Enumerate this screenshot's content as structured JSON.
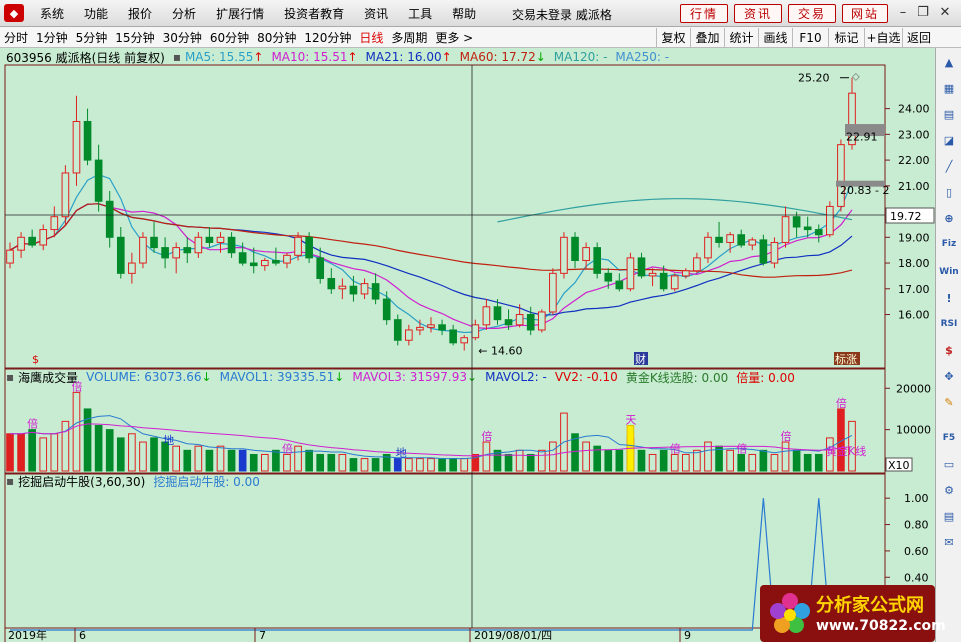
{
  "menu": {
    "logo_icon": "app-logo-icon",
    "items": [
      "系统",
      "功能",
      "报价",
      "分析",
      "扩展行情",
      "投资者教育",
      "资讯",
      "工具",
      "帮助"
    ],
    "status": "交易未登录 威派格",
    "right_buttons": [
      "行情",
      "资讯",
      "交易",
      "网站"
    ],
    "window_controls": [
      "minimize-icon",
      "restore-icon",
      "close-icon"
    ]
  },
  "tabs": {
    "periods": [
      "分时",
      "1分钟",
      "5分钟",
      "15分钟",
      "30分钟",
      "60分钟",
      "80分钟",
      "120分钟",
      "日线",
      "多周期",
      "更多 >"
    ],
    "active": "日线",
    "right": [
      "复权",
      "叠加",
      "统计",
      "画线",
      "F10",
      "标记",
      "+自选",
      "返回"
    ]
  },
  "main_info": {
    "title": "603956 威派格(日线 前复权)",
    "ma5": "MA5: 15.55",
    "ma10": "MA10: 15.51",
    "ma21": "MA21: 16.00",
    "ma60": "MA60: 17.72",
    "ma120": "MA120: -",
    "ma250": "MA250: -",
    "ma_colors": {
      "ma5": "#2aa0c8",
      "ma10": "#d020d0",
      "ma21": "#1030c0",
      "ma60": "#c02010",
      "ma120": "#30a0a0",
      "ma250": "#4090d0"
    }
  },
  "price_axis": [
    "24.00",
    "23.00",
    "22.00",
    "21.00",
    "20.00",
    "19.00",
    "18.00",
    "17.00",
    "16.00"
  ],
  "price_labels": {
    "high": "25.20",
    "low": "14.60",
    "mark1": "22.91",
    "mark2": "20.83 - 2",
    "crosshair": "19.72"
  },
  "markers": {
    "dollar": "$",
    "cai": "财",
    "biaozhang": "标涨"
  },
  "volume_info": {
    "name": "海鹰成交量",
    "volume": "VOLUME: 63073.66",
    "mavol1": "MAVOL1: 39335.51",
    "mavol3": "MAVOL3: 31597.93",
    "mavol2": "MAVOL2: -",
    "vv2": "VV2: -0.10",
    "gold": "黄金K线选股: 0.00",
    "beiliang": "倍量: 0.00",
    "axis": [
      "20000",
      "10000"
    ],
    "unit": "X10",
    "labels": {
      "bei": "倍",
      "di": "地",
      "tian": "天",
      "huangjin": "黄金K线"
    }
  },
  "indicator_info": {
    "name": "挖掘启动牛股(3,60,30)",
    "value": "挖掘启动牛股: 0.00",
    "axis": [
      "1.00",
      "0.80",
      "0.60",
      "0.40",
      "0.20"
    ]
  },
  "date_axis": [
    "2019年",
    "6",
    "7",
    "2019/08/01/四",
    "9"
  ],
  "watermark": {
    "line1": "分析家公式网",
    "line2": "www.70822.com"
  },
  "sidebar_icons": [
    "scroll-up-icon",
    "grid-icon",
    "bar-icon",
    "chart-icon",
    "line-icon",
    "candle-icon",
    "zoom-icon",
    "fiz-icon",
    "win-icon",
    "alert-icon",
    "rsi-icon",
    "money-icon",
    "move-icon",
    "pen-icon",
    "f5-icon",
    "window-icon",
    "settings-icon",
    "doc-icon",
    "email-icon"
  ],
  "chart_data": [
    {
      "type": "candlestick",
      "title": "603956 威派格(日线 前复权)",
      "y_axis": {
        "min": 14.0,
        "max": 25.5,
        "ticks": [
          16,
          17,
          18,
          19,
          20,
          21,
          22,
          23,
          24
        ]
      },
      "highest": 25.2,
      "lowest": 14.6,
      "candles": [
        [
          18.0,
          18.8,
          17.8,
          18.5
        ],
        [
          18.5,
          19.2,
          18.2,
          19.0
        ],
        [
          19.0,
          19.3,
          18.6,
          18.7
        ],
        [
          18.7,
          19.5,
          18.5,
          19.3
        ],
        [
          19.3,
          20.2,
          19.0,
          19.8
        ],
        [
          19.8,
          21.8,
          19.5,
          21.5
        ],
        [
          21.5,
          24.5,
          21.0,
          23.5
        ],
        [
          23.5,
          24.0,
          21.8,
          22.0
        ],
        [
          22.0,
          22.6,
          20.0,
          20.4
        ],
        [
          20.4,
          20.8,
          18.6,
          19.0
        ],
        [
          19.0,
          19.4,
          17.4,
          17.6
        ],
        [
          17.6,
          18.4,
          17.2,
          18.0
        ],
        [
          18.0,
          19.2,
          17.8,
          19.0
        ],
        [
          19.0,
          19.6,
          18.4,
          18.6
        ],
        [
          18.6,
          19.0,
          17.8,
          18.2
        ],
        [
          18.2,
          18.8,
          17.6,
          18.6
        ],
        [
          18.6,
          19.0,
          18.0,
          18.4
        ],
        [
          18.4,
          19.2,
          18.2,
          19.0
        ],
        [
          19.0,
          19.4,
          18.6,
          18.8
        ],
        [
          18.8,
          19.2,
          18.4,
          19.0
        ],
        [
          19.0,
          19.2,
          18.2,
          18.4
        ],
        [
          18.4,
          18.8,
          17.9,
          18.0
        ],
        [
          18.0,
          18.6,
          17.6,
          17.9
        ],
        [
          17.9,
          18.2,
          17.7,
          18.1
        ],
        [
          18.1,
          18.6,
          17.9,
          18.0
        ],
        [
          18.0,
          18.4,
          17.8,
          18.3
        ],
        [
          18.3,
          19.2,
          18.1,
          19.0
        ],
        [
          19.0,
          19.2,
          18.0,
          18.2
        ],
        [
          18.2,
          18.6,
          17.2,
          17.4
        ],
        [
          17.4,
          17.8,
          16.8,
          17.0
        ],
        [
          17.0,
          17.4,
          16.6,
          17.1
        ],
        [
          17.1,
          17.5,
          16.5,
          16.8
        ],
        [
          16.8,
          17.4,
          16.6,
          17.2
        ],
        [
          17.2,
          17.6,
          16.4,
          16.6
        ],
        [
          16.6,
          16.9,
          15.6,
          15.8
        ],
        [
          15.8,
          16.0,
          14.8,
          15.0
        ],
        [
          15.0,
          15.6,
          14.8,
          15.4
        ],
        [
          15.4,
          15.8,
          15.2,
          15.5
        ],
        [
          15.5,
          15.9,
          15.3,
          15.6
        ],
        [
          15.6,
          15.8,
          15.2,
          15.4
        ],
        [
          15.4,
          15.6,
          14.8,
          14.9
        ],
        [
          14.9,
          15.2,
          14.6,
          15.1
        ],
        [
          15.1,
          15.8,
          15.0,
          15.6
        ],
        [
          15.6,
          16.6,
          15.4,
          16.3
        ],
        [
          16.3,
          16.6,
          15.6,
          15.8
        ],
        [
          15.8,
          16.2,
          15.4,
          15.6
        ],
        [
          15.6,
          16.4,
          15.5,
          16.0
        ],
        [
          16.0,
          16.3,
          15.2,
          15.4
        ],
        [
          15.4,
          16.2,
          15.3,
          16.1
        ],
        [
          16.1,
          17.8,
          16.0,
          17.6
        ],
        [
          17.6,
          19.2,
          17.4,
          19.0
        ],
        [
          19.0,
          19.2,
          17.8,
          18.1
        ],
        [
          18.1,
          18.8,
          17.8,
          18.6
        ],
        [
          18.6,
          18.8,
          17.4,
          17.6
        ],
        [
          17.6,
          17.8,
          17.0,
          17.3
        ],
        [
          17.3,
          17.6,
          16.9,
          17.0
        ],
        [
          17.0,
          18.4,
          16.9,
          18.2
        ],
        [
          18.2,
          18.4,
          17.4,
          17.5
        ],
        [
          17.5,
          17.8,
          17.1,
          17.6
        ],
        [
          17.6,
          17.9,
          16.9,
          17.0
        ],
        [
          17.0,
          17.6,
          16.9,
          17.5
        ],
        [
          17.5,
          17.8,
          17.4,
          17.7
        ],
        [
          17.7,
          18.4,
          17.6,
          18.2
        ],
        [
          18.2,
          19.2,
          18.0,
          19.0
        ],
        [
          19.0,
          19.6,
          18.6,
          18.8
        ],
        [
          18.8,
          19.2,
          18.4,
          19.1
        ],
        [
          19.1,
          19.3,
          18.6,
          18.7
        ],
        [
          18.7,
          19.0,
          18.5,
          18.9
        ],
        [
          18.9,
          19.1,
          17.9,
          18.0
        ],
        [
          18.0,
          19.0,
          17.8,
          18.8
        ],
        [
          18.8,
          20.2,
          18.6,
          19.8
        ],
        [
          19.8,
          20.0,
          19.0,
          19.4
        ],
        [
          19.4,
          19.8,
          19.0,
          19.3
        ],
        [
          19.3,
          19.5,
          18.8,
          19.1
        ],
        [
          19.1,
          20.4,
          19.0,
          20.2
        ],
        [
          20.2,
          22.8,
          20.0,
          22.6
        ],
        [
          22.6,
          25.2,
          22.4,
          24.6
        ]
      ],
      "ma_lines": {
        "MA5": 15.55,
        "MA10": 15.51,
        "MA21": 16.0,
        "MA60": 17.72
      }
    },
    {
      "type": "bar",
      "title": "海鹰成交量",
      "y_axis": {
        "min": 0,
        "max": 22000,
        "ticks": [
          10000,
          20000
        ]
      },
      "values": [
        9,
        9,
        10,
        8,
        9,
        12,
        19,
        15,
        11,
        10,
        8,
        9,
        7,
        8,
        7,
        6,
        5,
        6,
        5,
        6,
        5,
        5,
        4,
        4,
        5,
        4,
        6,
        5,
        4,
        4,
        4,
        3,
        3,
        3,
        4,
        3,
        3,
        3,
        3,
        3,
        3,
        3,
        4,
        7,
        5,
        4,
        5,
        4,
        5,
        7,
        14,
        9,
        7,
        6,
        5,
        5,
        8,
        5,
        4,
        5,
        4,
        4,
        5,
        7,
        6,
        5,
        4,
        4,
        5,
        4,
        7,
        5,
        4,
        4,
        8,
        15,
        12
      ],
      "colors_rule": "red=up, green=down, blue=special"
    },
    {
      "type": "line",
      "title": "挖掘启动牛股(3,60,30)",
      "y_axis": {
        "min": 0,
        "max": 1.1,
        "ticks": [
          0.2,
          0.4,
          0.6,
          0.8,
          1.0
        ]
      },
      "values": [
        0,
        0,
        0,
        0,
        0,
        0,
        0,
        0,
        0,
        0,
        0,
        0,
        0,
        0,
        0,
        0,
        0,
        0,
        0,
        0,
        0,
        0,
        0,
        0,
        0,
        0,
        0,
        0,
        0,
        0,
        0,
        0,
        0,
        0,
        0,
        0,
        0,
        0,
        0,
        0,
        0,
        0,
        0,
        0,
        0,
        0,
        0,
        0,
        0,
        0,
        0,
        0,
        0,
        0,
        0,
        0,
        0,
        0,
        0,
        0,
        0,
        0,
        0,
        0,
        0,
        0,
        0,
        0,
        1,
        0,
        0,
        0,
        0,
        1,
        0,
        0,
        0
      ]
    }
  ]
}
